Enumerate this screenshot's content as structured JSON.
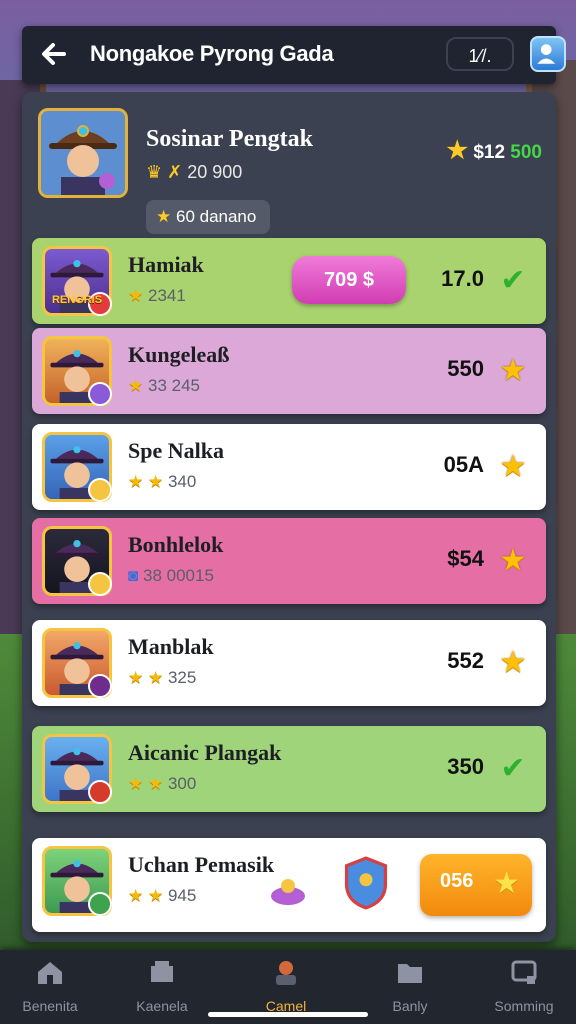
{
  "header": {
    "title": "Nongakoe Pyrong Gada",
    "counter": "1⁄/."
  },
  "profile": {
    "name": "Sosinar Pengtak",
    "crown_value": "20 900",
    "chip_text": "60 danano",
    "score_white": "$12",
    "score_green": "500"
  },
  "list": [
    {
      "name": "Hamiak",
      "stars": "2341",
      "pill": "709 $",
      "value": "17.0",
      "end_icon": "check-icon",
      "bg": "#a9d36e",
      "avatar_tag": "RENGRIS",
      "star_count": 1
    },
    {
      "name": "Kungeleaß",
      "stars": "33 245",
      "value": "550",
      "end_icon": "star-icon",
      "bg": "#dba8d8",
      "star_count": 1
    },
    {
      "name": "Spe Nalka",
      "stars": "340",
      "value": "05A",
      "end_icon": "star-icon",
      "bg": "#ffffff",
      "star_count": 2
    },
    {
      "name": "Bonhlelok",
      "stars": "38 00015",
      "value": "$54",
      "end_icon": "star-icon",
      "bg": "#e56fa4",
      "star_count": 0
    },
    {
      "name": "Manblak",
      "stars": "325",
      "value": "552",
      "end_icon": "star-icon",
      "bg": "#ffffff",
      "star_count": 2
    },
    {
      "name": "Aicanic Plangak",
      "stars": "300",
      "value": "350",
      "end_icon": "check-icon",
      "bg": "#9fd47b",
      "star_count": 2
    },
    {
      "name": "Uchan Pemasik",
      "stars": "945",
      "button_label": "056",
      "bg": "#ffffff",
      "star_count": 2
    }
  ],
  "nav": [
    {
      "label": "Benenita",
      "icon": "home-icon"
    },
    {
      "label": "Kaenela",
      "icon": "cards-icon"
    },
    {
      "label": "Camel",
      "icon": "character-icon",
      "active": true
    },
    {
      "label": "Banly",
      "icon": "folder-icon"
    },
    {
      "label": "Somming",
      "icon": "screen-icon"
    }
  ],
  "colors": {
    "accent": "#f3b43a",
    "panel": "#3b4150",
    "header": "#1f2430"
  }
}
